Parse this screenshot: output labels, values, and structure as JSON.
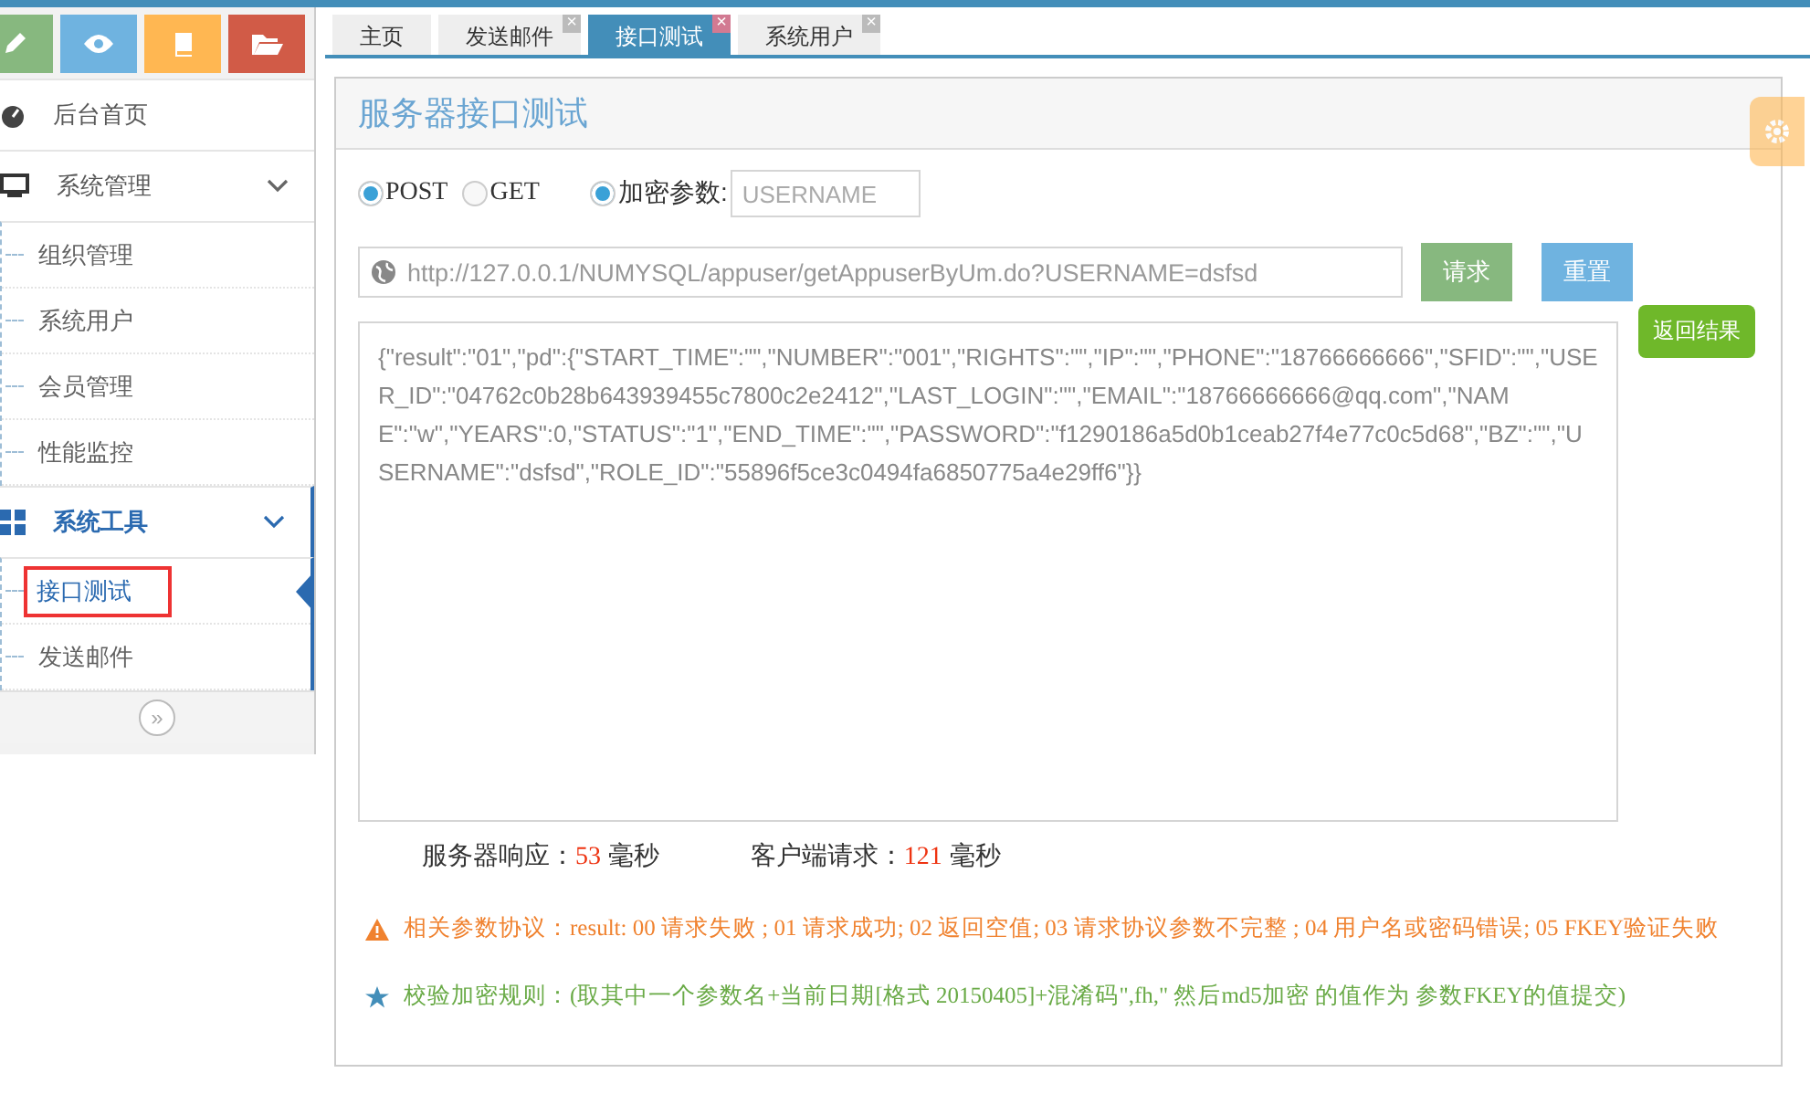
{
  "shortcuts": [
    {
      "kind": "pencil",
      "color": "#87b87f"
    },
    {
      "kind": "eye",
      "color": "#6fb3e0"
    },
    {
      "kind": "book",
      "color": "#ffb752"
    },
    {
      "kind": "folder",
      "color": "#d15b47"
    }
  ],
  "sidebar": {
    "items": [
      {
        "label": "后台首页",
        "kind": "dashboard",
        "active": false
      },
      {
        "label": "系统管理",
        "kind": "monitor",
        "expanded": true,
        "active": false,
        "children": [
          {
            "label": "组织管理",
            "selected": false
          },
          {
            "label": "系统用户",
            "selected": false
          },
          {
            "label": "会员管理",
            "selected": false
          },
          {
            "label": "性能监控",
            "selected": false
          }
        ]
      },
      {
        "label": "系统工具",
        "kind": "grid",
        "expanded": true,
        "active": true,
        "children": [
          {
            "label": "接口测试",
            "selected": true
          },
          {
            "label": "发送邮件",
            "selected": false
          }
        ]
      }
    ],
    "collapse": "»"
  },
  "tabs": [
    {
      "label": "主页",
      "selected": false
    },
    {
      "label": "发送邮件",
      "selected": false,
      "close": "×"
    },
    {
      "label": "接口测试",
      "selected": true,
      "close": "×"
    },
    {
      "label": "系统用户",
      "selected": false,
      "close": "×"
    }
  ],
  "panel": {
    "title": "服务器接口测试",
    "methods": [
      {
        "label": "POST",
        "selected": true
      },
      {
        "label": "GET",
        "selected": false
      }
    ],
    "encrypt": {
      "label": "加密参数:",
      "checked": true,
      "placeholder": "USERNAME"
    },
    "url": "http://127.0.0.1/NUMYSQL/appuser/getAppuserByUm.do?USERNAME=dsfsd",
    "buttons": [
      {
        "label": "请求",
        "kind": "primary"
      },
      {
        "label": "重置",
        "kind": "secondary"
      }
    ],
    "result": "{\"result\":\"01\",\"pd\":{\"START_TIME\":\"\",\"NUMBER\":\"001\",\"RIGHTS\":\"\",\"IP\":\"\",\"PHONE\":\"18766666666\",\"SFID\":\"\",\"USER_ID\":\"04762c0b28b643939455c7800c2e2412\",\"LAST_LOGIN\":\"\",\"EMAIL\":\"18766666666@qq.com\",\"NAME\":\"w\",\"YEARS\":0,\"STATUS\":\"1\",\"END_TIME\":\"\",\"PASSWORD\":\"f1290186a5d0b1ceab27f4e77c0c5d68\",\"BZ\":\"\",\"USERNAME\":\"dsfsd\",\"ROLE_ID\":\"55896f5ce3c0494fa6850775a4e29ff6\"}}",
    "result_tag": "返回结果",
    "timings": [
      {
        "label": "服务器响应：",
        "value": "53",
        "unit": "毫秒"
      },
      {
        "label": "客户端请求：",
        "value": "121",
        "unit": "毫秒"
      }
    ],
    "notes": [
      {
        "kind": "warning",
        "text": "相关参数协议：result: 00 请求失败 ; 01 请求成功; 02 返回空值; 03 请求协议参数不完整 ; 04 用户名或密码错误; 05 FKEY验证失败"
      },
      {
        "kind": "star",
        "text": "校验加密规则：(取其中一个参数名+当前日期[格式 20150405]+混淆码\",fh,\" 然后md5加密 的值作为 参数FKEY的值提交)"
      }
    ]
  }
}
